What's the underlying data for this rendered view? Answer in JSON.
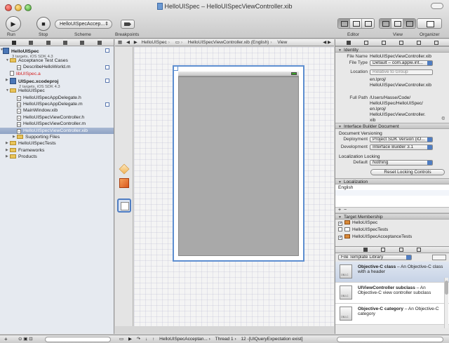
{
  "window": {
    "title": "HelloUISpec – HelloUISpecViewController.xib"
  },
  "toolbar": {
    "run_label": "Run",
    "stop_label": "Stop",
    "scheme_value": "HelloUISpecAccep...",
    "scheme_label": "Scheme",
    "breakpoints_label": "Breakpoints",
    "editor_label": "Editor",
    "view_label": "View",
    "organizer_label": "Organizer"
  },
  "navigator": {
    "project": {
      "name": "HelloUISpec",
      "subtitle": "3 targets, iOS SDK 4.3"
    },
    "items": [
      {
        "label": "Acceptance Test Cases",
        "kind": "folder",
        "indent": 1
      },
      {
        "label": "DescribeHelloWorld.m",
        "kind": "file",
        "glyph": "m",
        "indent": 2
      },
      {
        "label": "libUISpec.a",
        "kind": "file",
        "glyph": "",
        "indent": 1,
        "missing": true
      }
    ],
    "subproject": {
      "name": "UISpec.xcodeproj",
      "subtitle": "2 targets, iOS SDK 4.3"
    },
    "group": {
      "label": "HelloUISpec",
      "files": [
        {
          "label": "HelloUISpecAppDelegate.h",
          "glyph": "h"
        },
        {
          "label": "HelloUISpecAppDelegate.m",
          "glyph": "m"
        },
        {
          "label": "MainWindow.xib",
          "glyph": "x"
        },
        {
          "label": "HelloUISpecViewController.h",
          "glyph": "h"
        },
        {
          "label": "HelloUISpecViewController.m",
          "glyph": "m"
        },
        {
          "label": "HelloUISpecViewController.xib",
          "glyph": "x",
          "selected": true
        }
      ]
    },
    "supporting": "Supporting Files",
    "tail": [
      "HelloUISpecTests",
      "Frameworks",
      "Products"
    ]
  },
  "jumpbar": {
    "crumbs": [
      "HelloUISpec",
      "View"
    ],
    "file": "HelloUISpecViewController.xib (English)",
    "last": "View"
  },
  "inspector": {
    "identity": {
      "header": "Identity",
      "file_name_label": "File Name",
      "file_name": "HelloUISpecViewController.xib",
      "file_type_label": "File Type",
      "file_type": "Default – com.apple.int...",
      "location_label": "Location",
      "location": "Relative to Group",
      "location_path": "en.lproj/ HelloUISpecViewController.xib",
      "full_path_label": "Full Path",
      "full_path": "/Users/Hasse/Code/ HelloUISpec/HelloUISpec/ en.lproj/ HelloUISpecViewController. xib"
    },
    "ibdoc": {
      "header": "Interface Builder Document",
      "versioning_label": "Document Versioning",
      "deployment_label": "Deployment",
      "deployment": "Project SDK Version (iO...",
      "development_label": "Development",
      "development": "Interface Builder 3.1",
      "locking_label": "Localization Locking",
      "default_label": "Default",
      "default_value": "Nothing",
      "reset_button": "Reset Locking Controls"
    },
    "localization": {
      "header": "Localization",
      "languages": [
        "English"
      ]
    },
    "membership": {
      "header": "Target Membership",
      "targets": [
        {
          "name": "HelloUISpec",
          "checked": true
        },
        {
          "name": "HelloUISpecTests",
          "checked": false
        },
        {
          "name": "HelloUISpecAcceptanceTests",
          "checked": true
        }
      ]
    },
    "library": {
      "selector": "File Template Library",
      "items": [
        {
          "title": "Objective-C class",
          "desc": " – An Objective-C class with a header",
          "selected": true
        },
        {
          "title": "UIViewController subclass",
          "desc": " – An Objective-C view controller subclass",
          "selected": false
        },
        {
          "title": "Objective-C category",
          "desc": " – An Objective-C category",
          "selected": false
        }
      ]
    }
  },
  "debugbar": {
    "crumbs": [
      "HelloUISpecAcceptan...",
      "Thread 1",
      "12 -[UIQueryExpectation exist]"
    ]
  }
}
